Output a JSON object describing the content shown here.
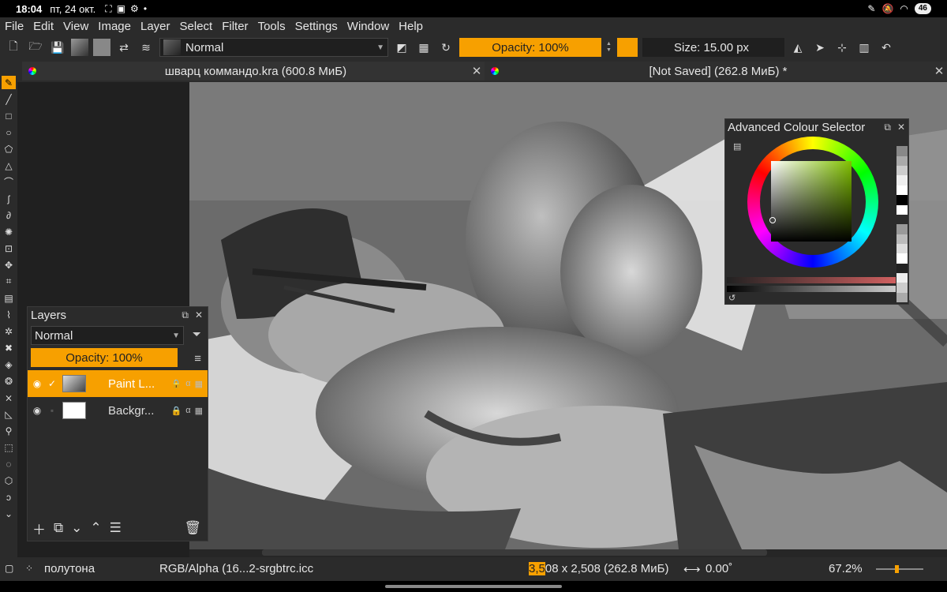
{
  "status_bar": {
    "time": "18:04",
    "date": "пт, 24 окт.",
    "battery": "46"
  },
  "menu": [
    "File",
    "Edit",
    "View",
    "Image",
    "Layer",
    "Select",
    "Filter",
    "Tools",
    "Settings",
    "Window",
    "Help"
  ],
  "toolbar": {
    "blend_mode": "Normal",
    "opacity_label": "Opacity: 100%",
    "size_label": "Size: 15.00 px",
    "fg_color": "#f7a000"
  },
  "tabs": [
    {
      "title": "шварц коммандо.kra (600.8 МиБ)"
    },
    {
      "title": "[Not Saved]  (262.8 МиБ) *"
    }
  ],
  "layers_docker": {
    "title": "Layers",
    "blend_mode": "Normal",
    "opacity_label": "Opacity:  100%",
    "layers": [
      {
        "name": "Paint L...",
        "selected": true
      },
      {
        "name": "Backgr...",
        "selected": false
      }
    ]
  },
  "colour_selector": {
    "title": "Advanced Colour Selector"
  },
  "statusbar_bottom": {
    "brush": "полутона",
    "color_profile": "RGB/Alpha (16...2-srgbtrc.icc",
    "width_highlight": "3,5",
    "dimensions_rest": "08 x 2,508 (262.8 МиБ)",
    "rotation": "0.00˚",
    "zoom": "67.2%"
  },
  "colors": {
    "accent": "#f7a000",
    "panel": "#2b2b2b",
    "canvas_bg": "#202020"
  }
}
